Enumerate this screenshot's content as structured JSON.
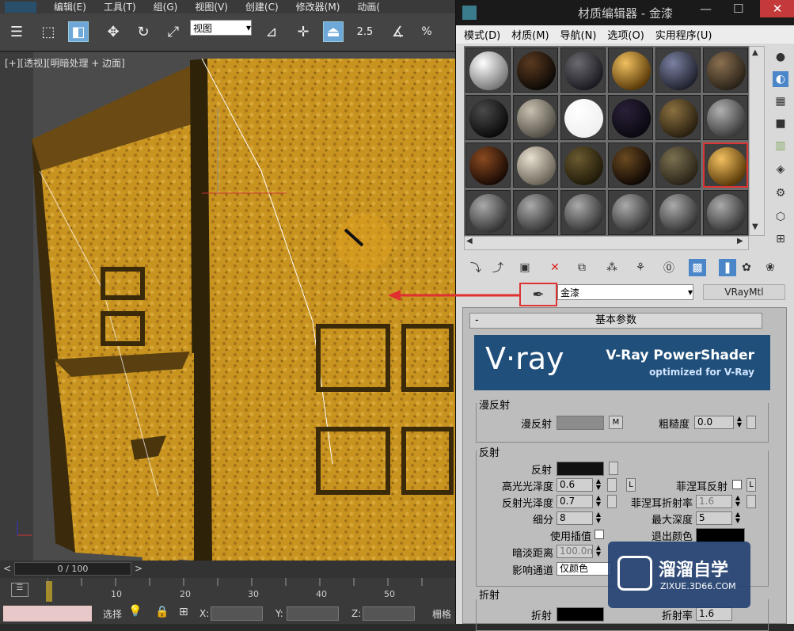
{
  "main_menu": [
    "编辑(E)",
    "工具(T)",
    "组(G)",
    "视图(V)",
    "创建(C)",
    "修改器(M)",
    "动画("
  ],
  "toolbar": {
    "view_select": "视图",
    "snap_angle": "2.5",
    "percent": "%"
  },
  "viewport": {
    "label": "[+][透视][明暗处理 + 边面]"
  },
  "timeline": {
    "position": "0 / 100",
    "prev": "<",
    "next": ">",
    "ticks": [
      "10",
      "20",
      "30",
      "40",
      "50"
    ]
  },
  "statusbar": {
    "select_label": "选择",
    "x_label": "X:",
    "y_label": "Y:",
    "z_label": "Z:",
    "grid_label": "栅格"
  },
  "material_editor": {
    "title": "材质编辑器 - 金漆",
    "menu": [
      "模式(D)",
      "材质(M)",
      "导航(N)",
      "选项(O)",
      "实用程序(U)"
    ],
    "material_name": "金漆",
    "material_type": "VRayMtl",
    "rollout_title": "基本参数",
    "banner": {
      "logo": "V·ray",
      "line1": "V-Ray PowerShader",
      "line2": "optimized for V-Ray"
    },
    "diffuse": {
      "group": "漫反射",
      "diffuse_label": "漫反射",
      "map_button": "M",
      "roughness_label": "粗糙度",
      "roughness": "0.0"
    },
    "reflection": {
      "group": "反射",
      "reflect_label": "反射",
      "hilight_gloss_label": "高光光泽度",
      "hilight_gloss": "0.6",
      "lock_button": "L",
      "fresnel_label": "菲涅耳反射",
      "fresnel_lock": "L",
      "refl_gloss_label": "反射光泽度",
      "refl_gloss": "0.7",
      "fresnel_ior_label": "菲涅耳折射率",
      "fresnel_ior": "1.6",
      "subdivs_label": "细分",
      "subdivs": "8",
      "max_depth_label": "最大深度",
      "max_depth": "5",
      "use_interp_label": "使用插值",
      "exit_color_label": "退出颜色",
      "dim_distance_label": "暗淡距离",
      "dim_distance": "100.0m",
      "affect_channels_label": "影响通道",
      "affect_channels": "仅颜色"
    },
    "refraction": {
      "group": "折射",
      "refract_label": "折射",
      "ior_label": "折射率",
      "ior": "1.6"
    }
  },
  "watermark": {
    "name": "溜溜自学",
    "url": "ZIXUE.3D66.COM"
  }
}
